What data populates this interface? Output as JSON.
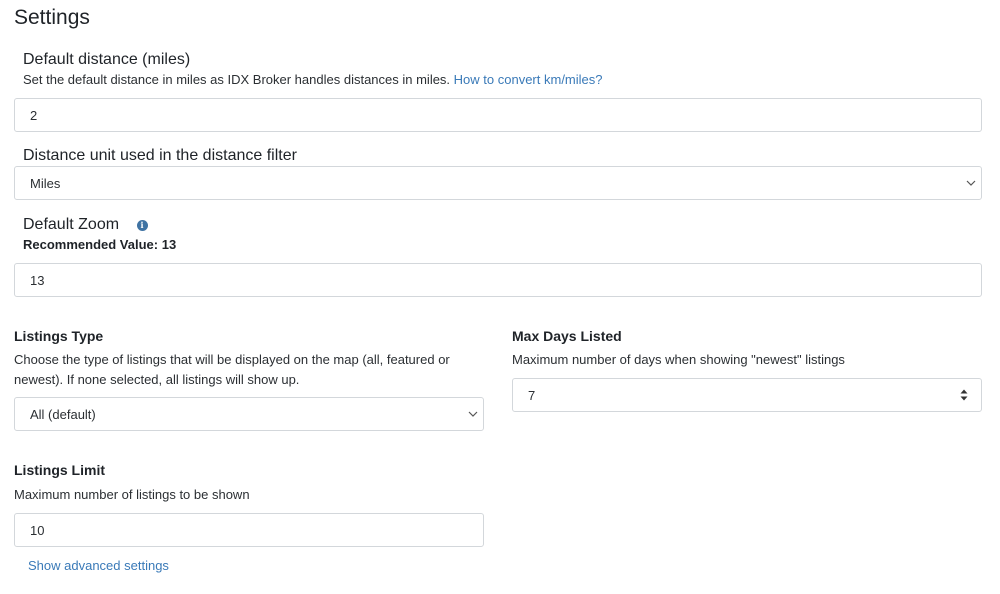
{
  "page": {
    "title": "Settings"
  },
  "default_distance": {
    "heading": "Default distance (miles)",
    "help": "Set the default distance in miles as IDX Broker handles distances in miles.",
    "help_link": "How to convert km/miles?",
    "value": "2"
  },
  "distance_unit": {
    "heading": "Distance unit used in the distance filter",
    "selected": "Miles"
  },
  "default_zoom": {
    "heading": "Default Zoom",
    "recommended": "Recommended Value: 13",
    "value": "13",
    "info_icon": "info-icon"
  },
  "listings_type": {
    "heading": "Listings Type",
    "help": "Choose the type of listings that will be displayed on the map (all, featured or newest). If none selected, all listings will show up.",
    "selected": "All (default)"
  },
  "max_days_listed": {
    "heading": "Max Days Listed",
    "help": "Maximum number of days when showing \"newest\" listings",
    "value": "7"
  },
  "listings_limit": {
    "heading": "Listings Limit",
    "help": "Maximum number of listings to be shown",
    "value": "10"
  },
  "advanced": {
    "link": "Show advanced settings"
  },
  "colors": {
    "link": "#3a7ab8",
    "info": "#3f73a3",
    "border": "#d3d7db"
  }
}
